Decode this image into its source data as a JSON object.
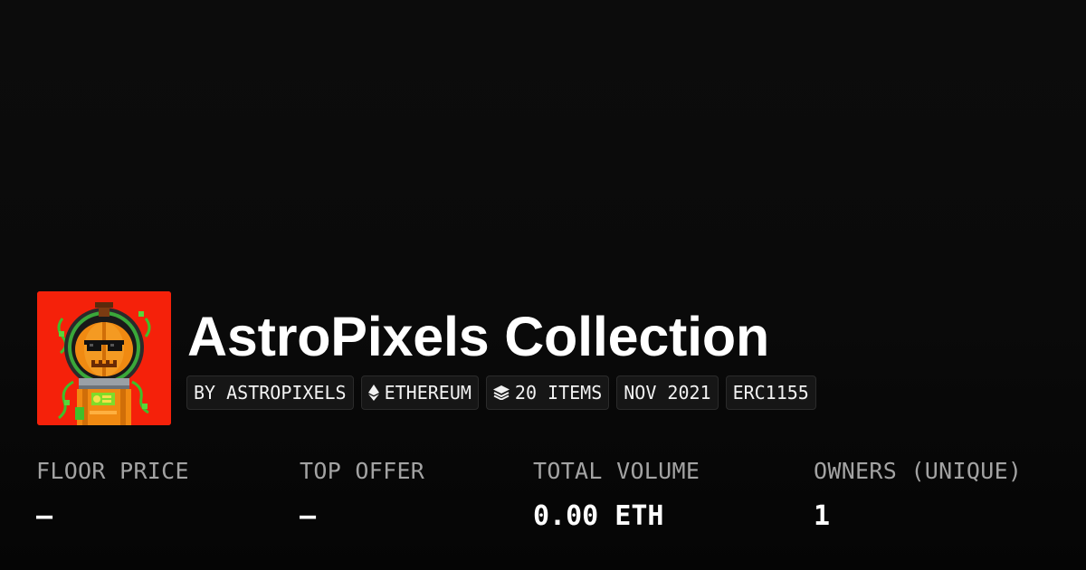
{
  "collection": {
    "name": "AstroPixels Collection",
    "avatar_alt": "pixel pumpkin astronaut avatar"
  },
  "chips": [
    {
      "label": "BY ASTROPIXELS",
      "icon": null
    },
    {
      "label": "ETHEREUM",
      "icon": "ethereum-icon"
    },
    {
      "label": "20 ITEMS",
      "icon": "layers-icon"
    },
    {
      "label": "NOV 2021",
      "icon": null
    },
    {
      "label": "ERC1155",
      "icon": null
    }
  ],
  "stats": [
    {
      "label": "FLOOR PRICE",
      "value": "–"
    },
    {
      "label": "TOP OFFER",
      "value": "–"
    },
    {
      "label": "TOTAL VOLUME",
      "value": "0.00 ETH"
    },
    {
      "label": "OWNERS (UNIQUE)",
      "value": "1"
    }
  ],
  "colors": {
    "background": "#0a0a0a",
    "avatar_background": "#f5210a",
    "chip_background": "#161616",
    "label_gray": "#a3a3a3"
  }
}
